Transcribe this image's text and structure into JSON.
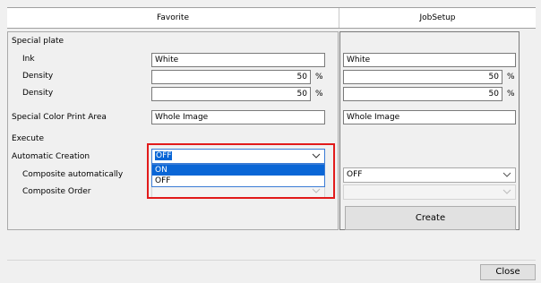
{
  "header": {
    "col_favorite": "Favorite",
    "col_jobsetup": "JobSetup"
  },
  "left": {
    "special_plate": "Special plate",
    "ink_label": "Ink",
    "ink_value": "White",
    "density1_label": "Density",
    "density1_value": "50",
    "density2_label": "Density",
    "density2_value": "50",
    "percent": "%",
    "print_area_label": "Special Color Print Area",
    "print_area_value": "Whole Image",
    "execute_label": "Execute",
    "auto_creation_label": "Automatic Creation",
    "auto_creation_value": "OFF",
    "auto_creation_options": [
      "ON",
      "OFF"
    ],
    "composite_auto_label": "Composite automatically",
    "composite_order_label": "Composite Order"
  },
  "right": {
    "ink_value": "White",
    "density1_value": "50",
    "density2_value": "50",
    "percent": "%",
    "print_area_value": "Whole Image",
    "composite_auto_value": "OFF",
    "composite_order_value": "",
    "create_label": "Create"
  },
  "footer": {
    "close_label": "Close"
  },
  "colors": {
    "highlight": "#e21b1b",
    "selection": "#0a66d6"
  }
}
